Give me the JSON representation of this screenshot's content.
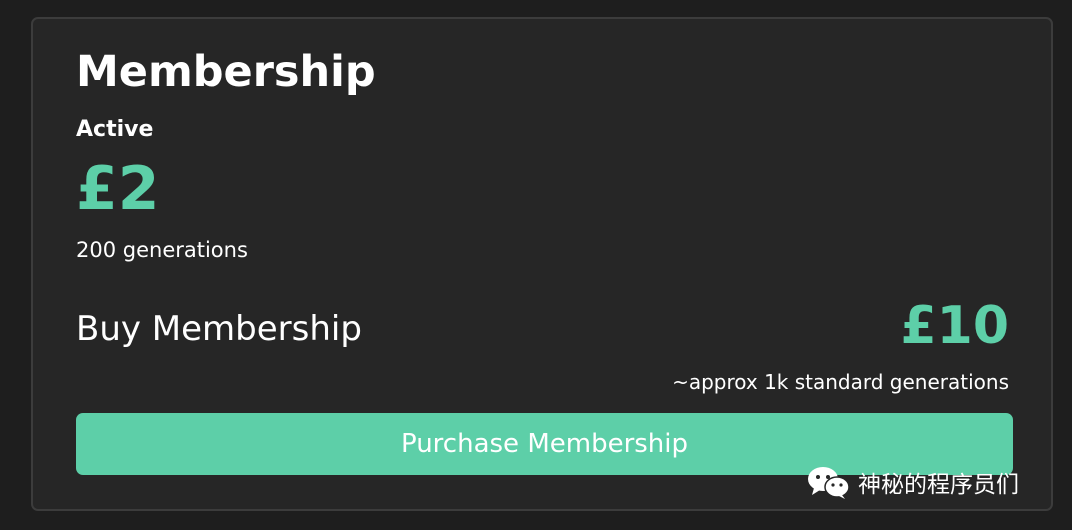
{
  "membership": {
    "title": "Membership",
    "status": "Active",
    "price": "£2",
    "generations": "200 generations"
  },
  "buy": {
    "label": "Buy Membership",
    "price": "£10",
    "approx": "~approx 1k standard generations",
    "button_label": "Purchase Membership"
  },
  "watermark": {
    "icon": "wechat-icon",
    "text": "神秘的程序员们"
  },
  "colors": {
    "accent": "#5dcfa8",
    "background": "#1e1e1e",
    "card": "#262626",
    "border": "#3c3c3c",
    "text": "#ffffff"
  }
}
